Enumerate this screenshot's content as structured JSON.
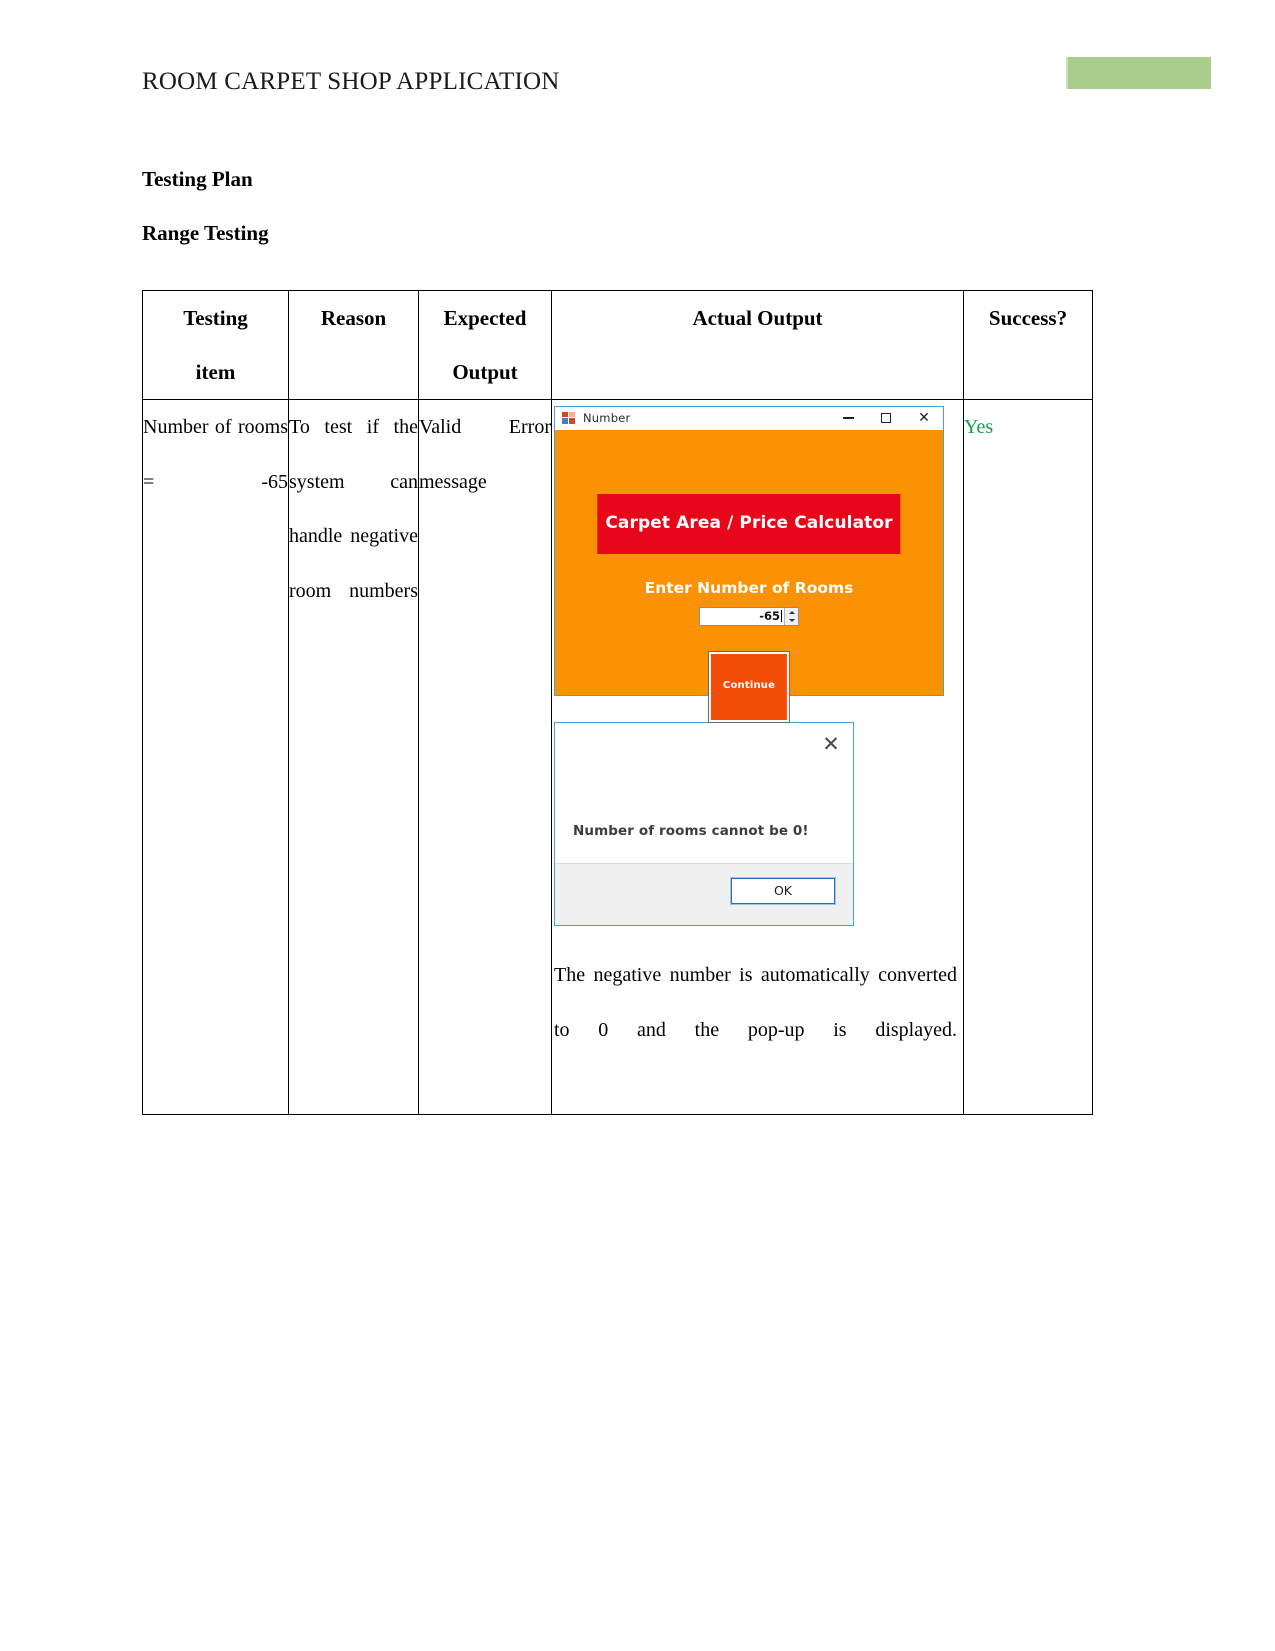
{
  "document": {
    "header_title": "ROOM CARPET SHOP APPLICATION",
    "headings": {
      "testing_plan": "Testing Plan",
      "range_testing": "Range Testing"
    },
    "accent_green": "#a9ce8c"
  },
  "table": {
    "headers": {
      "testing_item_line1": "Testing",
      "testing_item_line2": "item",
      "reason": "Reason",
      "expected_output_line1": "Expected",
      "expected_output_line2": "Output",
      "actual_output": "Actual Output",
      "success": "Success?"
    },
    "row": {
      "testing_item": "Number of rooms = -65",
      "reason": "To test if the system can handle negative room numbers",
      "expected_output": "Valid Error message",
      "success": "Yes",
      "success_color": "#169c4f",
      "caption": "The negative number is automatically converted to 0 and the pop-up is displayed."
    }
  },
  "app_window": {
    "title": "Number",
    "icon": "vs-form-icon",
    "minimize_label": "─",
    "maximize_label": "□",
    "close_label": "✕",
    "form_title": "Carpet Area / Price Calculator",
    "form_subtitle": "Enter Number of Rooms",
    "input_value": "-65",
    "continue_label": "Continue",
    "background_color": "#fb9203",
    "title_badge_color": "#e8061a",
    "button_color": "#f24e07"
  },
  "message_box": {
    "text": "Number of rooms cannot be 0!",
    "ok_label": "OK",
    "close_label": "✕"
  }
}
